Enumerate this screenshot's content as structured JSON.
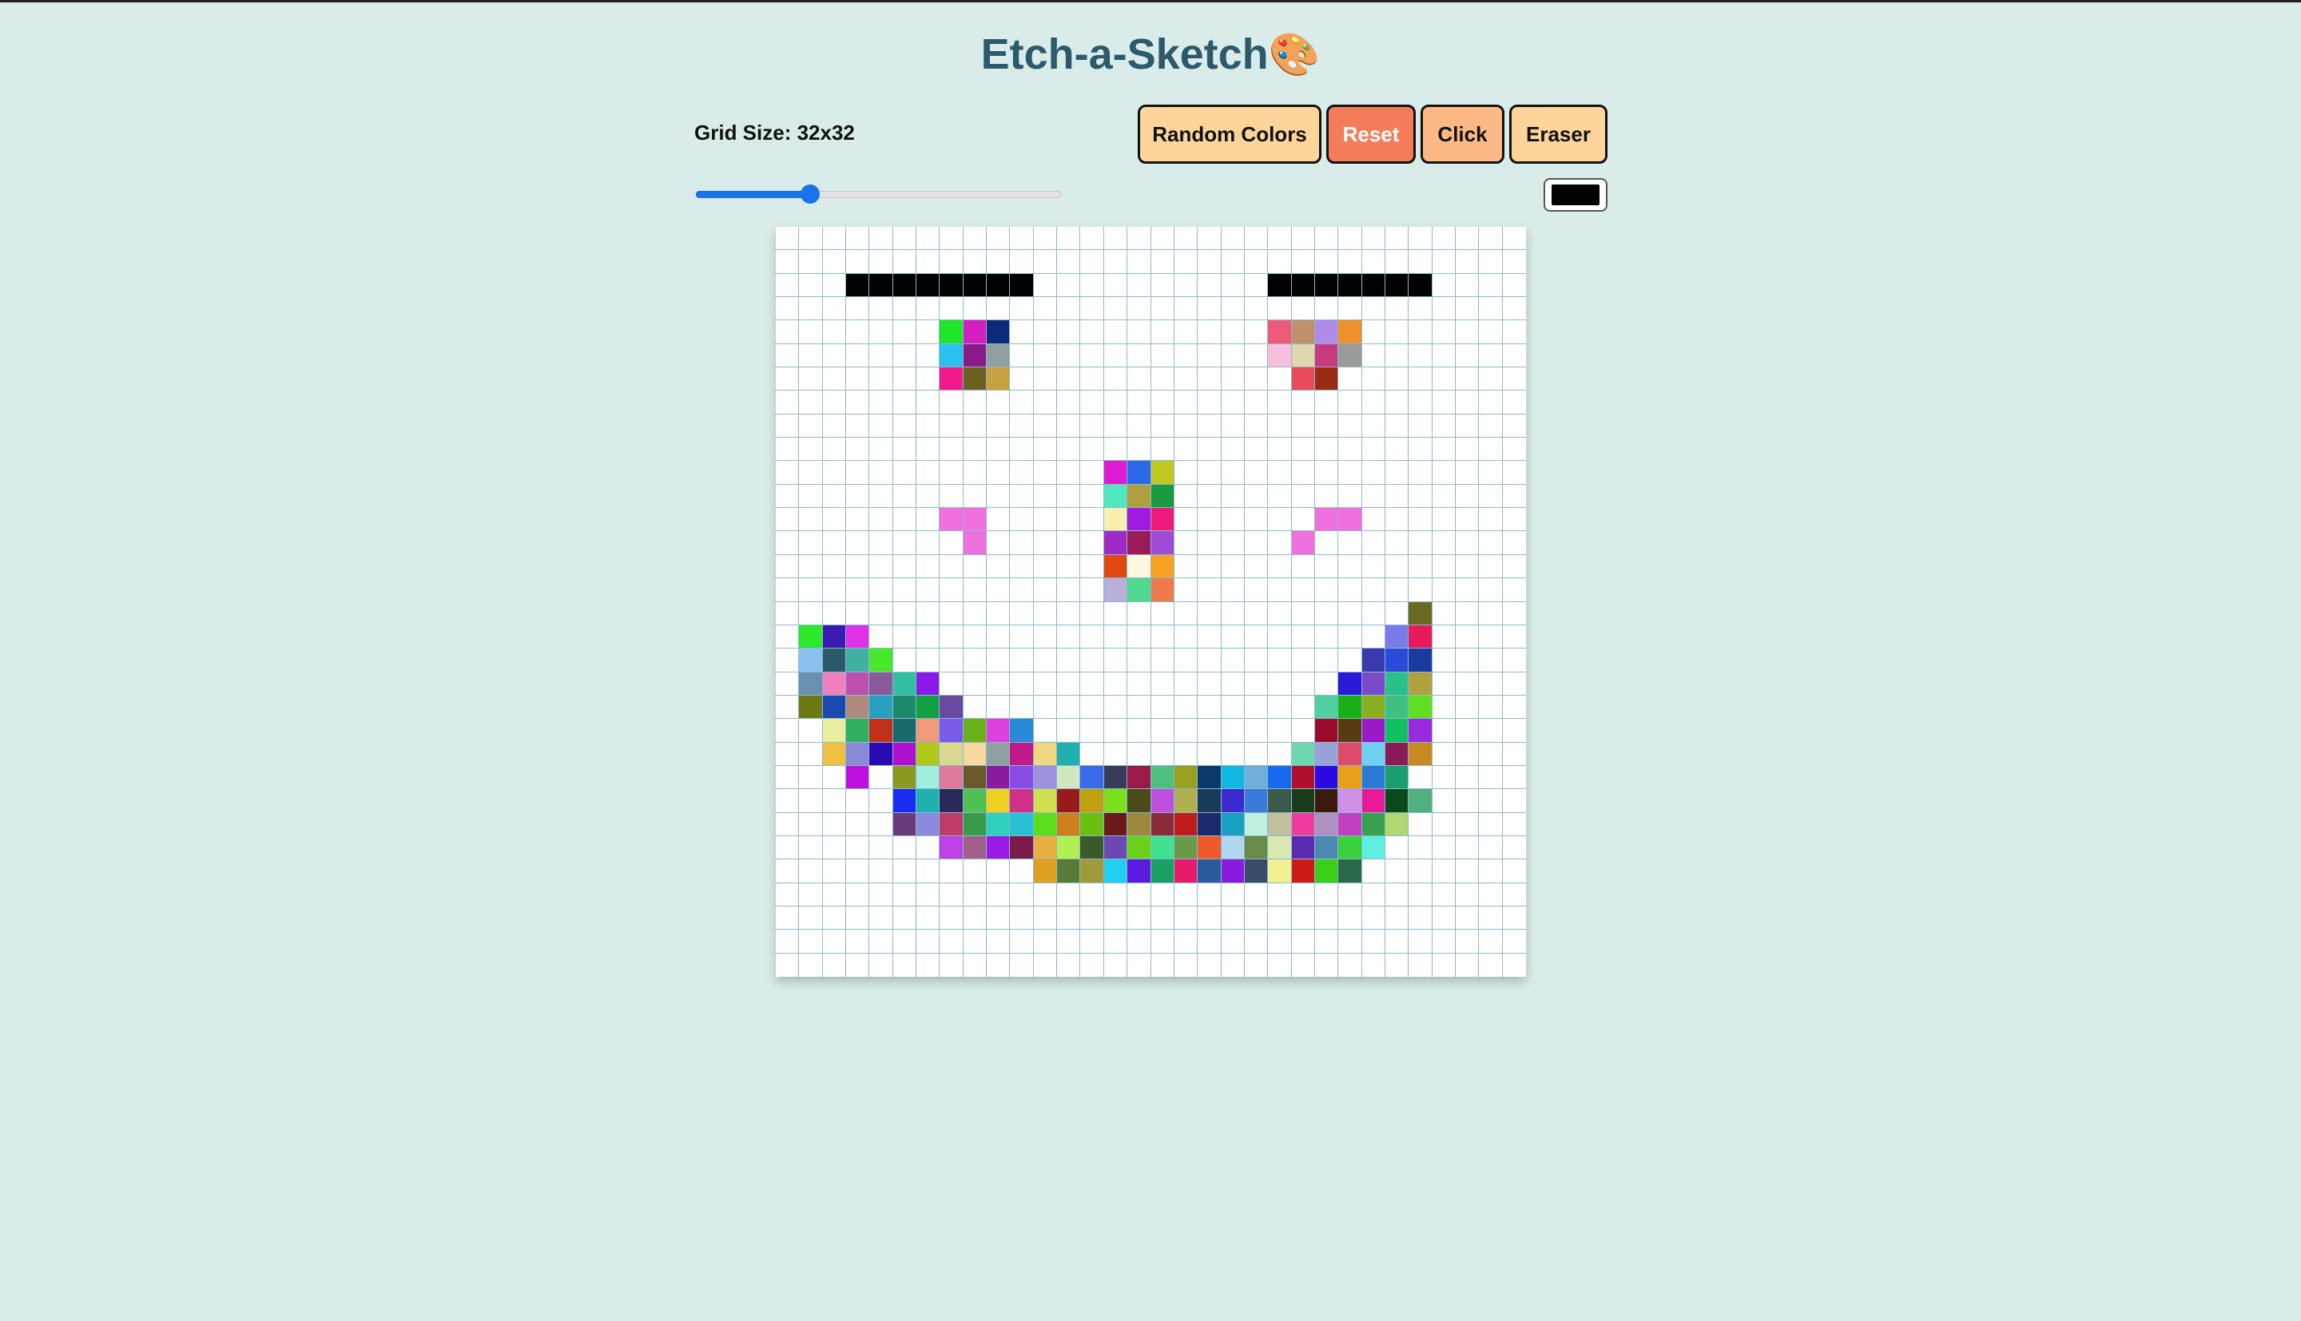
{
  "app": {
    "title": "Etch-a-Sketch",
    "title_emoji": "🎨"
  },
  "controls": {
    "grid_size_label": "Grid Size: 32x32",
    "grid_size": 32,
    "slider_min": 1,
    "slider_max": 100,
    "slider_value": 32,
    "random_colors_label": "Random Colors",
    "reset_label": "Reset",
    "click_label": "Click",
    "eraser_label": "Eraser",
    "color_value": "#000000"
  },
  "colors": {
    "background": "#d9ecea",
    "title": "#2d5a6b",
    "gridline": "#8bb8cf",
    "cell_default": "#ffffff",
    "accent": "#1a73e8"
  },
  "grid": {
    "size": 32,
    "cells": [
      [
        2,
        3,
        "#000"
      ],
      [
        2,
        4,
        "#000"
      ],
      [
        2,
        5,
        "#000"
      ],
      [
        2,
        6,
        "#000"
      ],
      [
        2,
        7,
        "#000"
      ],
      [
        2,
        8,
        "#000"
      ],
      [
        2,
        9,
        "#000"
      ],
      [
        2,
        10,
        "#000"
      ],
      [
        2,
        21,
        "#000"
      ],
      [
        2,
        22,
        "#000"
      ],
      [
        2,
        23,
        "#000"
      ],
      [
        2,
        24,
        "#000"
      ],
      [
        2,
        25,
        "#000"
      ],
      [
        2,
        26,
        "#000"
      ],
      [
        2,
        27,
        "#000"
      ],
      [
        4,
        7,
        "#1ee62a"
      ],
      [
        4,
        8,
        "#d41fc0"
      ],
      [
        4,
        9,
        "#0d2a7a"
      ],
      [
        4,
        21,
        "#ee5a7a"
      ],
      [
        4,
        22,
        "#c0906a"
      ],
      [
        4,
        23,
        "#b08ae8"
      ],
      [
        4,
        24,
        "#f0902a"
      ],
      [
        5,
        7,
        "#2ac0f0"
      ],
      [
        5,
        8,
        "#8a1a8a"
      ],
      [
        5,
        9,
        "#90a0a0"
      ],
      [
        5,
        21,
        "#f6c0dc"
      ],
      [
        5,
        22,
        "#e0d6b0"
      ],
      [
        5,
        23,
        "#c83a80"
      ],
      [
        5,
        24,
        "#9a9a9a"
      ],
      [
        6,
        7,
        "#f01a8a"
      ],
      [
        6,
        8,
        "#6a6020"
      ],
      [
        6,
        9,
        "#c8a040"
      ],
      [
        6,
        22,
        "#e84a5a"
      ],
      [
        6,
        23,
        "#9a2a10"
      ],
      [
        10,
        14,
        "#e01ad0"
      ],
      [
        10,
        15,
        "#2a6ae8"
      ],
      [
        10,
        16,
        "#c0c820"
      ],
      [
        11,
        14,
        "#50e8c0"
      ],
      [
        11,
        15,
        "#b0a040"
      ],
      [
        11,
        16,
        "#1a9a40"
      ],
      [
        12,
        7,
        "#f070e0"
      ],
      [
        12,
        8,
        "#f070e0"
      ],
      [
        12,
        14,
        "#f8f0b0"
      ],
      [
        12,
        15,
        "#a01ae0"
      ],
      [
        12,
        16,
        "#f01a7a"
      ],
      [
        12,
        23,
        "#f070e0"
      ],
      [
        12,
        24,
        "#f070e0"
      ],
      [
        13,
        8,
        "#f070e0"
      ],
      [
        13,
        14,
        "#a02ac8"
      ],
      [
        13,
        15,
        "#9a1a5a"
      ],
      [
        13,
        16,
        "#a04ad8"
      ],
      [
        13,
        22,
        "#f070e0"
      ],
      [
        14,
        14,
        "#e04a10"
      ],
      [
        14,
        15,
        "#fff8e0"
      ],
      [
        14,
        16,
        "#f8a020"
      ],
      [
        15,
        14,
        "#b8b0d8"
      ],
      [
        15,
        15,
        "#50d890"
      ],
      [
        15,
        16,
        "#f07a4a"
      ],
      [
        16,
        27,
        "#6a6a20"
      ],
      [
        17,
        1,
        "#2ae82a"
      ],
      [
        17,
        2,
        "#3a1ab0"
      ],
      [
        17,
        3,
        "#e030e8"
      ],
      [
        17,
        26,
        "#7a7ae8"
      ],
      [
        17,
        27,
        "#e81a5a"
      ],
      [
        18,
        1,
        "#8ac0f0"
      ],
      [
        18,
        2,
        "#2a5a6a"
      ],
      [
        18,
        3,
        "#40b0a0"
      ],
      [
        18,
        4,
        "#4ae82a"
      ],
      [
        18,
        25,
        "#3a3ab0"
      ],
      [
        18,
        26,
        "#2a4ad8"
      ],
      [
        18,
        27,
        "#1a3aa0"
      ],
      [
        19,
        1,
        "#6a90b0"
      ],
      [
        19,
        2,
        "#f080c0"
      ],
      [
        19,
        3,
        "#c050b0"
      ],
      [
        19,
        4,
        "#8a5a9a"
      ],
      [
        19,
        5,
        "#30c0a0"
      ],
      [
        19,
        6,
        "#8a1ae8"
      ],
      [
        19,
        24,
        "#2a1ad8"
      ],
      [
        19,
        25,
        "#7a4ac8"
      ],
      [
        19,
        26,
        "#2ac08a"
      ],
      [
        19,
        27,
        "#b0a040"
      ],
      [
        20,
        1,
        "#6a7a10"
      ],
      [
        20,
        2,
        "#1a4ab0"
      ],
      [
        20,
        3,
        "#b08a7a"
      ],
      [
        20,
        4,
        "#2aa0c0"
      ],
      [
        20,
        5,
        "#1a8a6a"
      ],
      [
        20,
        6,
        "#10a040"
      ],
      [
        20,
        7,
        "#6a4aa0"
      ],
      [
        20,
        23,
        "#50d0a0"
      ],
      [
        20,
        24,
        "#1ab01a"
      ],
      [
        20,
        25,
        "#8ab020"
      ],
      [
        20,
        26,
        "#40c080"
      ],
      [
        20,
        27,
        "#60e020"
      ],
      [
        21,
        2,
        "#e8f0a0"
      ],
      [
        21,
        3,
        "#30b060"
      ],
      [
        21,
        4,
        "#c0301a"
      ],
      [
        21,
        5,
        "#1a6a6a"
      ],
      [
        21,
        6,
        "#f09a7a"
      ],
      [
        21,
        7,
        "#7a5ae8"
      ],
      [
        21,
        8,
        "#6ab01a"
      ],
      [
        21,
        9,
        "#e040e0"
      ],
      [
        21,
        10,
        "#2a8ad8"
      ],
      [
        21,
        23,
        "#9a0a2a"
      ],
      [
        21,
        24,
        "#5a3a10"
      ],
      [
        21,
        25,
        "#9a1ac8"
      ],
      [
        21,
        26,
        "#10c060"
      ],
      [
        21,
        27,
        "#9a2ae0"
      ],
      [
        22,
        2,
        "#f0c040"
      ],
      [
        22,
        3,
        "#8a8ad8"
      ],
      [
        22,
        4,
        "#2a0ab0"
      ],
      [
        22,
        5,
        "#b010d0"
      ],
      [
        22,
        6,
        "#b0c81a"
      ],
      [
        22,
        7,
        "#d8d890"
      ],
      [
        22,
        8,
        "#f8d8a0"
      ],
      [
        22,
        9,
        "#90a0a0"
      ],
      [
        22,
        10,
        "#c01a8a"
      ],
      [
        22,
        11,
        "#f0d880"
      ],
      [
        22,
        12,
        "#20b0b0"
      ],
      [
        22,
        22,
        "#70d8b0"
      ],
      [
        22,
        23,
        "#9aa0d8"
      ],
      [
        22,
        24,
        "#e04a6a"
      ],
      [
        22,
        25,
        "#70d0f0"
      ],
      [
        22,
        26,
        "#8a1a5a"
      ],
      [
        22,
        27,
        "#c88a20"
      ],
      [
        23,
        3,
        "#c010e0"
      ],
      [
        23,
        5,
        "#8a9a20"
      ],
      [
        23,
        6,
        "#a0f0e0"
      ],
      [
        23,
        7,
        "#e07a9a"
      ],
      [
        23,
        8,
        "#6a5a2a"
      ],
      [
        23,
        9,
        "#8a1aa0"
      ],
      [
        23,
        10,
        "#8a4ae8"
      ],
      [
        23,
        11,
        "#a090e0"
      ],
      [
        23,
        12,
        "#d0e8c0"
      ],
      [
        23,
        13,
        "#3a6ae8"
      ],
      [
        23,
        14,
        "#3a3a5a"
      ],
      [
        23,
        15,
        "#9a1a4a"
      ],
      [
        23,
        16,
        "#50c080"
      ],
      [
        23,
        17,
        "#9aa020"
      ],
      [
        23,
        18,
        "#0a3a6a"
      ],
      [
        23,
        19,
        "#10b8e0"
      ],
      [
        23,
        20,
        "#70b0d8"
      ],
      [
        23,
        21,
        "#1a6af0"
      ],
      [
        23,
        22,
        "#b0102a"
      ],
      [
        23,
        23,
        "#2a0ae0"
      ],
      [
        23,
        24,
        "#e8a01a"
      ],
      [
        23,
        25,
        "#2a7ad8"
      ],
      [
        23,
        26,
        "#1aa070"
      ],
      [
        24,
        5,
        "#1a2af0"
      ],
      [
        24,
        6,
        "#20b0b0"
      ],
      [
        24,
        7,
        "#2a2a5a"
      ],
      [
        24,
        8,
        "#50c050"
      ],
      [
        24,
        9,
        "#f0d020"
      ],
      [
        24,
        10,
        "#d0308a"
      ],
      [
        24,
        11,
        "#d0e050"
      ],
      [
        24,
        12,
        "#9a1a1a"
      ],
      [
        24,
        13,
        "#c0a010"
      ],
      [
        24,
        14,
        "#7ae01a"
      ],
      [
        24,
        15,
        "#4a4a1a"
      ],
      [
        24,
        16,
        "#c050e0"
      ],
      [
        24,
        17,
        "#b0b050"
      ],
      [
        24,
        18,
        "#1a3a5a"
      ],
      [
        24,
        19,
        "#3a2ad0"
      ],
      [
        24,
        20,
        "#3a7ad8"
      ],
      [
        24,
        21,
        "#3a5a4a"
      ],
      [
        24,
        22,
        "#1a3a1a"
      ],
      [
        24,
        23,
        "#3a1a0a"
      ],
      [
        24,
        24,
        "#d090e8"
      ],
      [
        24,
        25,
        "#e81a9a"
      ],
      [
        24,
        26,
        "#0a4a1a"
      ],
      [
        24,
        27,
        "#50b080"
      ],
      [
        25,
        5,
        "#6a3a7a"
      ],
      [
        25,
        6,
        "#8a8ae0"
      ],
      [
        25,
        7,
        "#c03a6a"
      ],
      [
        25,
        8,
        "#3a9a4a"
      ],
      [
        25,
        9,
        "#30d0c0"
      ],
      [
        25,
        10,
        "#2ac0d8"
      ],
      [
        25,
        11,
        "#5ae01a"
      ],
      [
        25,
        12,
        "#d0801a"
      ],
      [
        25,
        13,
        "#6ac010"
      ],
      [
        25,
        14,
        "#6a1a1a"
      ],
      [
        25,
        15,
        "#9a8a3a"
      ],
      [
        25,
        16,
        "#8a2a3a"
      ],
      [
        25,
        17,
        "#c01a1a"
      ],
      [
        25,
        18,
        "#1a2a6a"
      ],
      [
        25,
        19,
        "#1aa0c0"
      ],
      [
        25,
        20,
        "#c0f0e0"
      ],
      [
        25,
        21,
        "#c0c0a0"
      ],
      [
        25,
        22,
        "#f03aa0"
      ],
      [
        25,
        23,
        "#b090c0"
      ],
      [
        25,
        24,
        "#c040c0"
      ],
      [
        25,
        25,
        "#3aa050"
      ],
      [
        25,
        26,
        "#b0d870"
      ],
      [
        26,
        7,
        "#c040e8"
      ],
      [
        26,
        8,
        "#a0608a"
      ],
      [
        26,
        9,
        "#9a1ae8"
      ],
      [
        26,
        10,
        "#7a1a4a"
      ],
      [
        26,
        11,
        "#e8b040"
      ],
      [
        26,
        12,
        "#b0f050"
      ],
      [
        26,
        13,
        "#3a5a2a"
      ],
      [
        26,
        14,
        "#6a4ab0"
      ],
      [
        26,
        15,
        "#6ad01a"
      ],
      [
        26,
        16,
        "#40e090"
      ],
      [
        26,
        17,
        "#6a9a4a"
      ],
      [
        26,
        18,
        "#f05a2a"
      ],
      [
        26,
        19,
        "#b0d8f0"
      ],
      [
        26,
        20,
        "#6a8a4a"
      ],
      [
        26,
        21,
        "#d8e8b0"
      ],
      [
        26,
        22,
        "#5a2ab0"
      ],
      [
        26,
        23,
        "#4a8ab0"
      ],
      [
        26,
        24,
        "#3ad040"
      ],
      [
        26,
        25,
        "#60f0e0"
      ],
      [
        27,
        11,
        "#e0a020"
      ],
      [
        27,
        12,
        "#5a7a3a"
      ],
      [
        27,
        13,
        "#a09a3a"
      ],
      [
        27,
        14,
        "#20d0f0"
      ],
      [
        27,
        15,
        "#5a1ae0"
      ],
      [
        27,
        16,
        "#1aa060"
      ],
      [
        27,
        17,
        "#e81a6a"
      ],
      [
        27,
        18,
        "#2a5a9a"
      ],
      [
        27,
        19,
        "#8a1ae0"
      ],
      [
        27,
        20,
        "#3a4a6a"
      ],
      [
        27,
        21,
        "#f0f090"
      ],
      [
        27,
        22,
        "#d01a1a"
      ],
      [
        27,
        23,
        "#3ad01a"
      ],
      [
        27,
        24,
        "#2a6a4a"
      ]
    ]
  }
}
